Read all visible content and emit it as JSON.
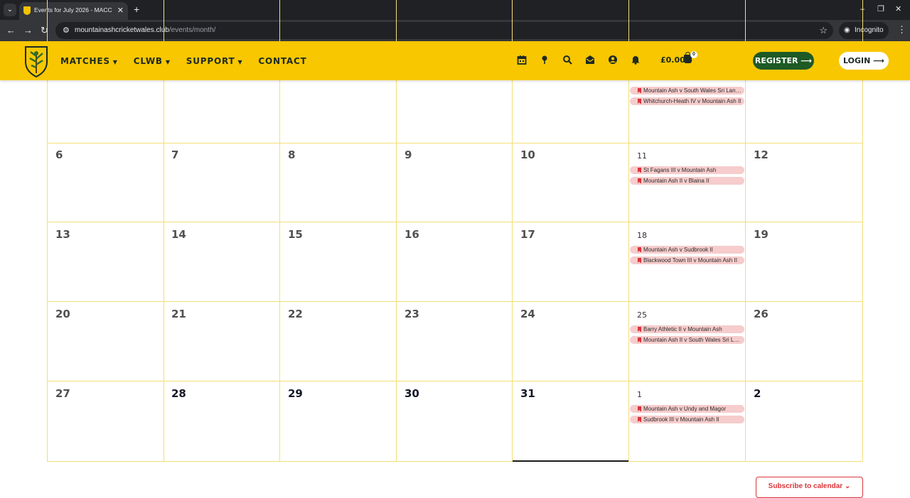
{
  "browser": {
    "tab_title": "Events for July 2026 - MACC M",
    "url_domain": "mountainashcricketwales.club",
    "url_path": "/events/month/",
    "incognito_label": "Incognito"
  },
  "header": {
    "nav": [
      {
        "label": "MATCHES",
        "has_caret": true
      },
      {
        "label": "CLWB",
        "has_caret": true
      },
      {
        "label": "SUPPORT",
        "has_caret": true
      },
      {
        "label": "CONTACT",
        "has_caret": false
      }
    ],
    "icons": [
      "calendar-icon",
      "location-pin-icon",
      "search-icon",
      "mail-icon",
      "user-icon",
      "bell-icon"
    ],
    "cart_amount": "£0.00",
    "cart_count": "0",
    "register_label": "REGISTER",
    "login_label": "LOGIN",
    "brand_color": "#f8c700",
    "register_color": "#1d5a25"
  },
  "calendar": {
    "rows": [
      [
        {
          "day": "",
          "events": []
        },
        {
          "day": "",
          "events": []
        },
        {
          "day": "",
          "events": []
        },
        {
          "day": "",
          "events": []
        },
        {
          "day": "",
          "events": []
        },
        {
          "day": "",
          "events": [
            "Mountain Ash v South Wales Sri Lank...",
            "Whitchurch-Heath IV v Mountain Ash II"
          ]
        },
        {
          "day": "",
          "events": []
        }
      ],
      [
        {
          "day": "6",
          "events": []
        },
        {
          "day": "7",
          "events": []
        },
        {
          "day": "8",
          "events": []
        },
        {
          "day": "9",
          "events": []
        },
        {
          "day": "10",
          "events": []
        },
        {
          "day": "11",
          "events": [
            "St Fagans III v Mountain Ash",
            "Mountain Ash II v Blaina II"
          ]
        },
        {
          "day": "12",
          "events": []
        }
      ],
      [
        {
          "day": "13",
          "events": []
        },
        {
          "day": "14",
          "events": []
        },
        {
          "day": "15",
          "events": []
        },
        {
          "day": "16",
          "events": []
        },
        {
          "day": "17",
          "events": []
        },
        {
          "day": "18",
          "events": [
            "Mountain Ash v Sudbrook II",
            "Blackwood Town III v Mountain Ash II"
          ]
        },
        {
          "day": "19",
          "events": []
        }
      ],
      [
        {
          "day": "20",
          "events": []
        },
        {
          "day": "21",
          "events": []
        },
        {
          "day": "22",
          "events": []
        },
        {
          "day": "23",
          "events": []
        },
        {
          "day": "24",
          "events": []
        },
        {
          "day": "25",
          "events": [
            "Barry Athletic II v Mountain Ash",
            "Mountain Ash II v South Wales Sri La..."
          ]
        },
        {
          "day": "26",
          "events": []
        }
      ],
      [
        {
          "day": "27",
          "events": []
        },
        {
          "day": "28",
          "events": []
        },
        {
          "day": "29",
          "events": []
        },
        {
          "day": "30",
          "events": []
        },
        {
          "day": "31",
          "events": []
        },
        {
          "day": "1",
          "events": [
            "Mountain Ash v Undy and Magor",
            "Sudbrook III v Mountain Ash II"
          ]
        },
        {
          "day": "2",
          "events": []
        }
      ]
    ],
    "event_color": "#f6cccc"
  },
  "subscribe_label": "Subscribe to calendar"
}
